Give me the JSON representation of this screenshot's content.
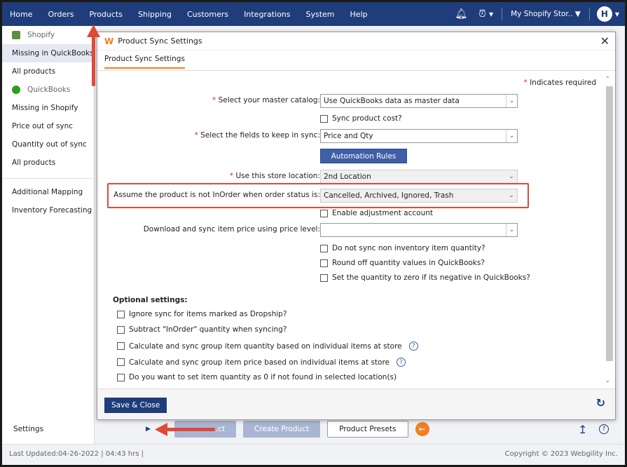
{
  "topnav": {
    "items": [
      "Home",
      "Orders",
      "Products",
      "Shipping",
      "Customers",
      "Integrations",
      "System",
      "Help"
    ],
    "store": "My Shopify Stor..",
    "avatar": "H"
  },
  "sidebar": {
    "shopify_head": "Shopify",
    "shopify_items": [
      "Missing in QuickBooks",
      "All products"
    ],
    "qb_head": "QuickBooks",
    "qb_items": [
      "Missing in Shopify",
      "Price out of sync",
      "Quantity out of sync",
      "All products"
    ],
    "extra_items": [
      "Additional Mapping",
      "Inventory Forecasting"
    ],
    "settings": "Settings"
  },
  "bottom_buttons": {
    "sync": "…ct",
    "create": "Create Product",
    "presets": "Product Presets"
  },
  "status": {
    "updated": "Last Updated:04-26-2022 | 04:43 hrs |",
    "copyright": "Copyright © 2023 Webgility Inc."
  },
  "modal": {
    "title": "Product Sync Settings",
    "tab": "Product Sync Settings",
    "req_note": "Indicates required",
    "fields": {
      "master_catalog_label": "Select your master catalog:",
      "master_catalog_value": "Use QuickBooks data as master data",
      "sync_cost": "Sync product cost?",
      "keep_sync_label": "Select the fields to keep in sync:",
      "keep_sync_value": "Price and Qty",
      "automation": "Automation Rules",
      "location_label": "Use this store location:",
      "location_value": "2nd Location",
      "inorder_label": "Assume the product is not InOrder when order status is:",
      "inorder_value": "Cancelled, Archived, Ignored, Trash",
      "adjust": "Enable adjustment account",
      "price_level_label": "Download and sync item price using price level:",
      "price_level_value": "",
      "noninv": "Do not sync non inventory item quantity?",
      "roundoff": "Round off quantity values in QuickBooks?",
      "zero_neg": "Set the quantity to zero if its negative in QuickBooks?"
    },
    "optional": {
      "title": "Optional settings:",
      "items": [
        "Ignore sync for items marked as Dropship?",
        "Subtract \"InOrder\" quantity when syncing?",
        "Calculate and sync group item quantity based on individual items at store",
        "Calculate and sync group item price based on individual items at store",
        "Do you want to set item quantity as 0 if not found in selected location(s)"
      ]
    },
    "save": "Save & Close"
  },
  "colors": {
    "nav": "#1f3d7a",
    "accent": "#f08020",
    "highlight": "#d94b3a"
  }
}
